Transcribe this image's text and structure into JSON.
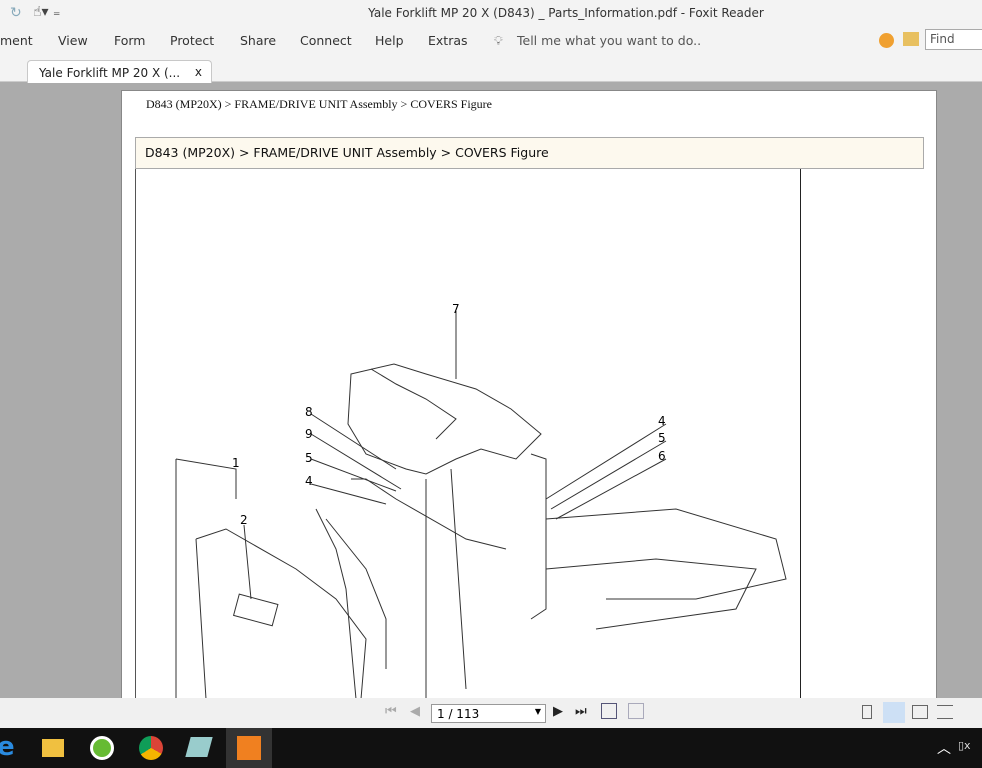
{
  "window": {
    "title": "Yale Forklift MP 20 X (D843) _ Parts_Information.pdf - Foxit Reader"
  },
  "menu": [
    "ment",
    "View",
    "Form",
    "Protect",
    "Share",
    "Connect",
    "Help",
    "Extras"
  ],
  "tell_me": "Tell me what you want to do..",
  "find_placeholder": "Find",
  "tab": {
    "label": "Yale Forklift MP 20 X (...",
    "close": "x"
  },
  "page": {
    "header": "D843 (MP20X) > FRAME/DRIVE UNIT Assembly > COVERS Figure",
    "breadcrumb": "D843 (MP20X) > FRAME/DRIVE UNIT Assembly > COVERS Figure",
    "callouts": [
      "7",
      "8",
      "9",
      "5",
      "4",
      "1",
      "2",
      "4",
      "5",
      "6"
    ]
  },
  "status": {
    "page_indicator": "1 / 113"
  }
}
